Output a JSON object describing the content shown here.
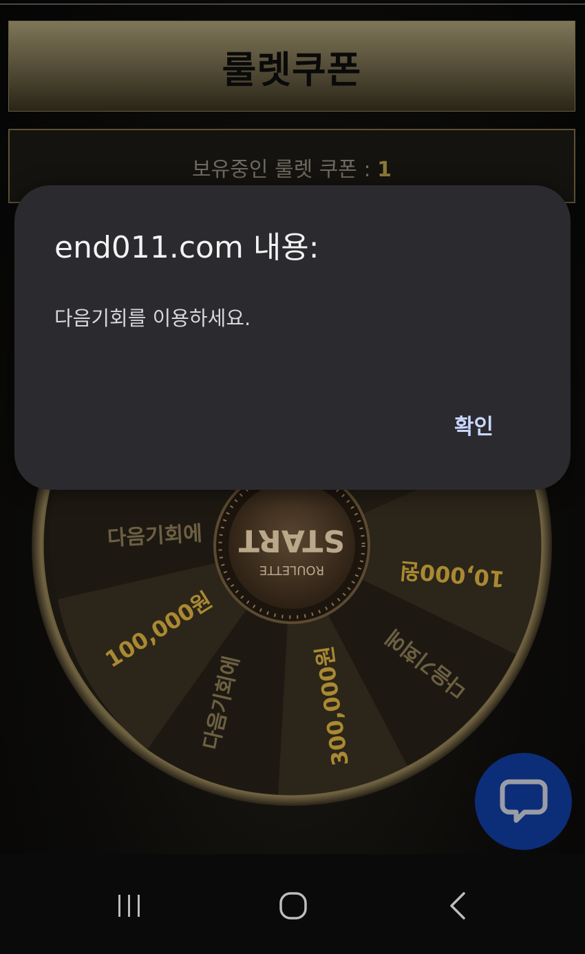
{
  "page": {
    "title": "룰렛쿠폰",
    "coupon_label": "보유중인 룰렛 쿠폰 : ",
    "coupon_count": "1"
  },
  "wheel": {
    "center_title": "START",
    "center_subtitle": "ROULETTE",
    "segments": [
      "다음기회에",
      "10,000원",
      "다음기회에",
      "300,000원",
      "다음기회에",
      "100,000원",
      "다음기회에"
    ]
  },
  "dialog": {
    "title": "end011.com 내용:",
    "message": "다음기회를 이용하세요.",
    "ok_label": "확인"
  },
  "icons": {
    "chat": "chat-bubble-icon",
    "recents": "recent-apps-icon",
    "home": "home-icon",
    "back": "back-icon"
  },
  "colors": {
    "accent_gold": "#c9a336",
    "dialog_bg": "#2b2a2f",
    "chat_blue": "#0c2d78"
  }
}
